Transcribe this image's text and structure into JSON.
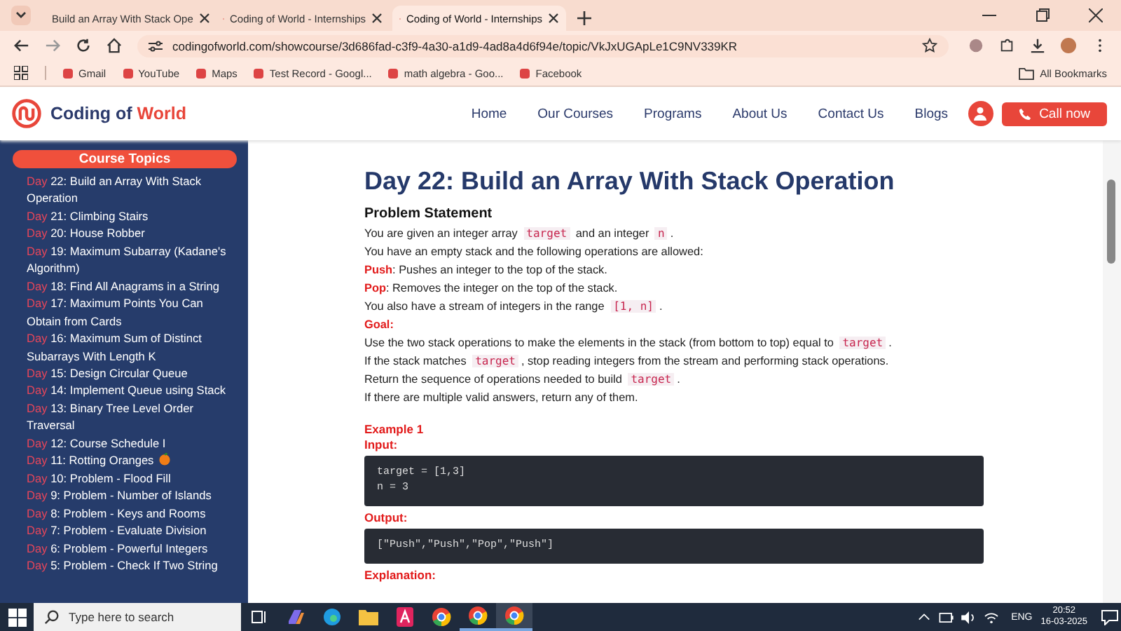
{
  "browser": {
    "tabs": [
      {
        "title": "Build an Array With Stack Ope",
        "selected": false
      },
      {
        "title": "Coding of World - Internships",
        "selected": false
      },
      {
        "title": "Coding of World - Internships",
        "selected": true
      }
    ],
    "address": "codingofworld.com/showcourse/3d686fad-c3f9-4a30-a1d9-4ad8a4d6f94e/topic/VkJxUGApLe1C9NV339KR",
    "bookmarks": [
      "Gmail",
      "YouTube",
      "Maps",
      "Test Record - Googl...",
      "math algebra - Goo...",
      "Facebook"
    ],
    "all_bookmarks": "All Bookmarks"
  },
  "site": {
    "logo_prefix": "Coding of",
    "logo_accent": "World",
    "nav": [
      "Home",
      "Our Courses",
      "Programs",
      "About Us",
      "Contact Us",
      "Blogs"
    ],
    "call_button": "Call now"
  },
  "sidebar": {
    "title": "Course Topics",
    "items": [
      {
        "day": "Day",
        "text": "22: Build an Array With Stack Operation",
        "orange_icon": false
      },
      {
        "day": "Day",
        "text": "21: Climbing Stairs",
        "orange_icon": false
      },
      {
        "day": "Day",
        "text": "20: House Robber",
        "orange_icon": false
      },
      {
        "day": "Day",
        "text": "19: Maximum Subarray (Kadane's Algorithm)",
        "orange_icon": false
      },
      {
        "day": "Day",
        "text": "18: Find All Anagrams in a String",
        "orange_icon": false
      },
      {
        "day": "Day",
        "text": "17: Maximum Points You Can Obtain from Cards",
        "orange_icon": false
      },
      {
        "day": "Day",
        "text": "16: Maximum Sum of Distinct Subarrays With Length K",
        "orange_icon": false
      },
      {
        "day": "Day",
        "text": "15: Design Circular Queue",
        "orange_icon": false
      },
      {
        "day": "Day",
        "text": "14: Implement Queue using Stack",
        "orange_icon": false
      },
      {
        "day": "Day",
        "text": "13: Binary Tree Level Order Traversal",
        "orange_icon": false
      },
      {
        "day": "Day",
        "text": "12: Course Schedule I",
        "orange_icon": false
      },
      {
        "day": "Day",
        "text": "11: Rotting Oranges",
        "orange_icon": true
      },
      {
        "day": "Day",
        "text": "10: Problem - Flood Fill",
        "orange_icon": false
      },
      {
        "day": "Day",
        "text": "9: Problem - Number of Islands",
        "orange_icon": false
      },
      {
        "day": "Day",
        "text": "8: Problem - Keys and Rooms",
        "orange_icon": false
      },
      {
        "day": "Day",
        "text": "7: Problem - Evaluate Division",
        "orange_icon": false
      },
      {
        "day": "Day",
        "text": "6: Problem - Powerful Integers",
        "orange_icon": false
      },
      {
        "day": "Day",
        "text": "5: Problem - Check If Two String",
        "orange_icon": false
      }
    ]
  },
  "article": {
    "title": "Day 22: Build an Array With Stack Operation",
    "section": "Problem Statement",
    "lines": [
      [
        {
          "kind": "text",
          "text": "You are given an integer array "
        },
        {
          "kind": "code",
          "text": "target"
        },
        {
          "kind": "text",
          "text": " and an integer "
        },
        {
          "kind": "code",
          "text": "n"
        },
        {
          "kind": "text",
          "text": "."
        }
      ],
      [
        {
          "kind": "text",
          "text": "You have an empty stack and the following operations are allowed:"
        }
      ],
      [
        {
          "kind": "label",
          "text": "Push"
        },
        {
          "kind": "text",
          "text": ": Pushes an integer to the top of the stack."
        }
      ],
      [
        {
          "kind": "label",
          "text": "Pop"
        },
        {
          "kind": "text",
          "text": ": Removes the integer on the top of the stack."
        }
      ],
      [
        {
          "kind": "text",
          "text": "You also have a stream of integers in the range "
        },
        {
          "kind": "code",
          "text": "[1, n]"
        },
        {
          "kind": "text",
          "text": "."
        }
      ],
      [
        {
          "kind": "label",
          "text": "Goal:"
        }
      ],
      [
        {
          "kind": "text",
          "text": "Use the two stack operations to make the elements in the stack (from bottom to top) equal to "
        },
        {
          "kind": "code",
          "text": "target"
        },
        {
          "kind": "text",
          "text": "."
        }
      ],
      [
        {
          "kind": "text",
          "text": "If the stack matches "
        },
        {
          "kind": "code",
          "text": "target"
        },
        {
          "kind": "text",
          "text": ", stop reading integers from the stream and performing stack operations."
        }
      ],
      [
        {
          "kind": "text",
          "text": "Return the sequence of operations needed to build "
        },
        {
          "kind": "code",
          "text": "target"
        },
        {
          "kind": "text",
          "text": "."
        }
      ],
      [
        {
          "kind": "text",
          "text": "If there are multiple valid answers, return any of them."
        }
      ]
    ],
    "example_title": "Example 1",
    "blocks": [
      {
        "label": "Input:",
        "code": [
          "target = [1,3]",
          "n = 3"
        ]
      },
      {
        "label": "Output:",
        "code": [
          "[\"Push\",\"Push\",\"Pop\",\"Push\"]"
        ]
      }
    ],
    "next_heading": "Explanation:"
  },
  "taskbar": {
    "search_placeholder": "Type here to search",
    "language": "ENG",
    "time": "20:52",
    "date": "16-03-2025"
  }
}
